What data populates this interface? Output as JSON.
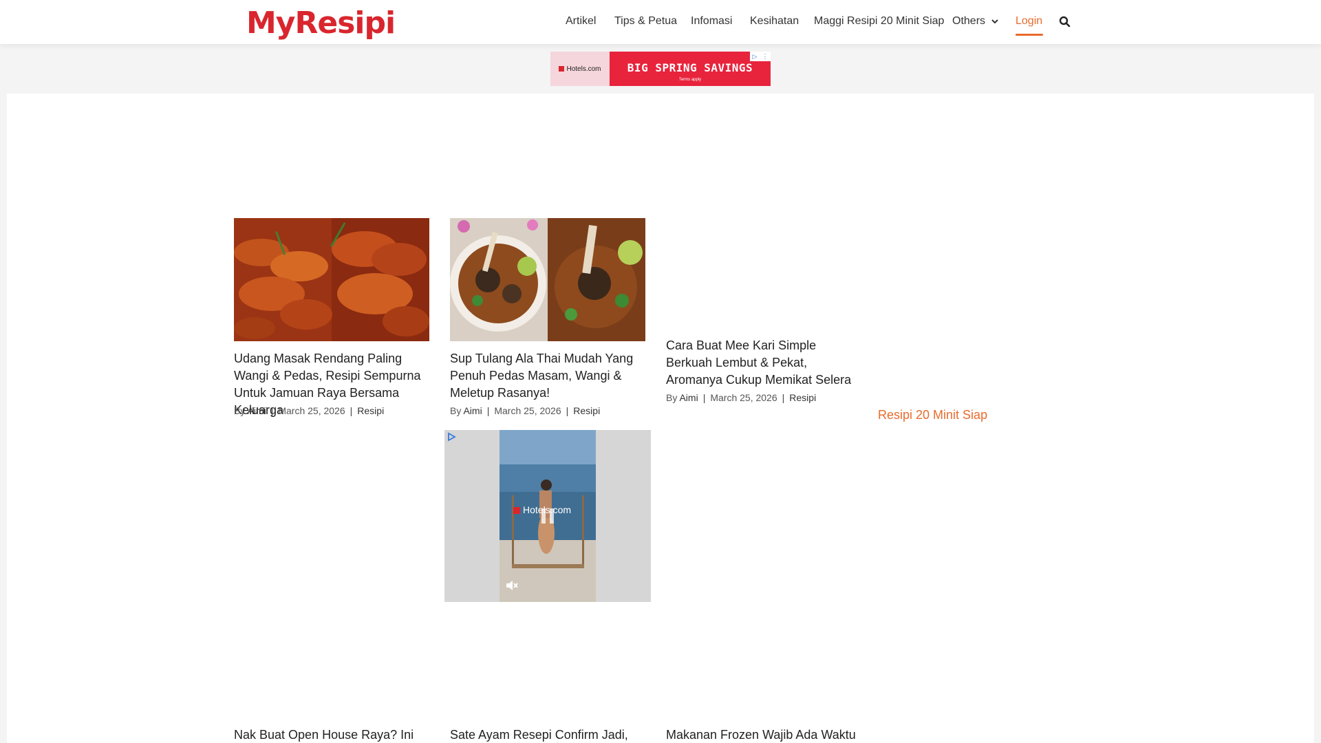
{
  "site": {
    "logo": "MyResipi"
  },
  "nav": {
    "items": [
      "Artikel",
      "Tips & Petua",
      "Infomasi",
      "Kesihatan",
      "Maggi Resipi 20 Minit Siap",
      "Others"
    ],
    "login": "Login"
  },
  "ad_banner": {
    "brand": "Hotels.com",
    "headline": "BIG SPRING SAVINGS",
    "terms": "Terms apply"
  },
  "posts": [
    {
      "title": "Udang Masak Rendang Paling Wangi & Pedas, Resipi Sempurna Untuk Jamuan Raya Bersama Keluarga",
      "by": "By",
      "author": "Aimi",
      "date": "March 25, 2026",
      "category": "Resipi"
    },
    {
      "title": "Sup Tulang Ala Thai Mudah Yang Penuh Pedas Masam, Wangi & Meletup Rasanya!",
      "by": "By",
      "author": "Aimi",
      "date": "March 25, 2026",
      "category": "Resipi"
    },
    {
      "title": "Cara Buat Mee Kari Simple Berkuah Lembut & Pekat, Aromanya Cukup Memikat Selera",
      "by": "By",
      "author": "Aimi",
      "date": "March 25, 2026",
      "category": "Resipi"
    }
  ],
  "sidebar": {
    "link": "Resipi 20 Minit Siap"
  },
  "video_ad": {
    "brand": "Hotels.com"
  },
  "next_posts": [
    "Nak Buat Open House Raya? Ini",
    "Sate Ayam Resepi Confirm Jadi,",
    "Makanan Frozen Wajib Ada Waktu"
  ],
  "colors": {
    "brand_red": "#d9262e",
    "accent_orange": "#e96a2c",
    "ad_red": "#e8233c"
  }
}
